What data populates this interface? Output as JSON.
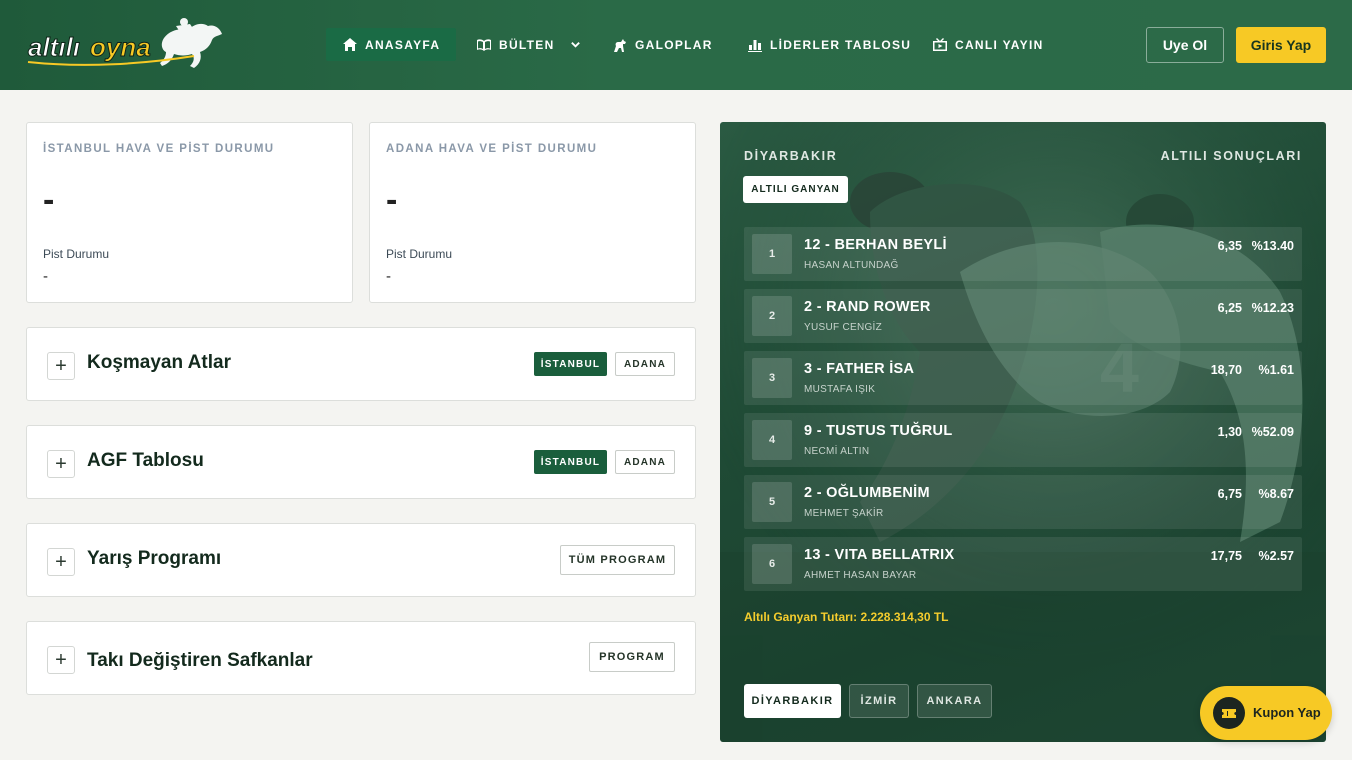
{
  "brand": {
    "name": "altılıoyna",
    "primary": "#1f5a3a",
    "accent": "#f7c925"
  },
  "nav": [
    {
      "label": "ANASAYFA",
      "icon": "home-icon"
    },
    {
      "label": "BÜLTEN",
      "icon": "book-icon"
    },
    {
      "label": "GALOPLAR",
      "icon": "horse-icon"
    },
    {
      "label": "LİDERLER TABLOSU",
      "icon": "chart-icon"
    },
    {
      "label": "CANLI YAYIN",
      "icon": "tv-icon"
    }
  ],
  "auth": {
    "register_label": "Uye Ol",
    "login_label": "Giris Yap"
  },
  "weather": [
    {
      "title": "İSTANBUL HAVA VE PİST DURUMU",
      "temp": "-",
      "track_label": "Pist Durumu",
      "track_value": "-"
    },
    {
      "title": "ADANA HAVA VE PİST DURUMU",
      "temp": "-",
      "track_label": "Pist Durumu",
      "track_value": "-"
    }
  ],
  "sections": [
    {
      "title": "Koşmayan Atlar",
      "tags": [
        "İSTANBUL",
        "ADANA"
      ]
    },
    {
      "title": "AGF Tablosu",
      "tags": [
        "İSTANBUL",
        "ADANA"
      ]
    },
    {
      "title": "Yarış Programı",
      "button": "TÜM PROGRAM"
    },
    {
      "title": "Takı Değiştiren Safkanlar",
      "button": "PROGRAM"
    }
  ],
  "results": {
    "city": "DİYARBAKIR",
    "heading": "ALTILI SONUÇLARI",
    "tab": "ALTILI GANYAN",
    "rows": [
      {
        "rank": "1",
        "horse": "12 - BERHAN BEYLİ",
        "jockey": "HASAN ALTUNDAĞ",
        "odds": "6,35",
        "pct": "%13.40"
      },
      {
        "rank": "2",
        "horse": "2 - RAND ROWER",
        "jockey": "YUSUF CENGİZ",
        "odds": "6,25",
        "pct": "%12.23"
      },
      {
        "rank": "3",
        "horse": "3 - FATHER İSA",
        "jockey": "MUSTAFA IŞIK",
        "odds": "18,70",
        "pct": "%1.61"
      },
      {
        "rank": "4",
        "horse": "9 - TUSTUS TUĞRUL",
        "jockey": "NECMİ ALTIN",
        "odds": "1,30",
        "pct": "%52.09"
      },
      {
        "rank": "5",
        "horse": "2 - OĞLUMBENİM",
        "jockey": "MEHMET ŞAKİR",
        "odds": "6,75",
        "pct": "%8.67"
      },
      {
        "rank": "6",
        "horse": "13 - VITA BELLATRIX",
        "jockey": "AHMET HASAN BAYAR",
        "odds": "17,75",
        "pct": "%2.57"
      }
    ],
    "payout": "Altılı Ganyan Tutarı: 2.228.314,30 TL",
    "cities": [
      "DİYARBAKIR",
      "İZMİR",
      "ANKARA"
    ]
  },
  "coupon": {
    "label": "Kupon Yap",
    "icon": "ticket-icon"
  }
}
